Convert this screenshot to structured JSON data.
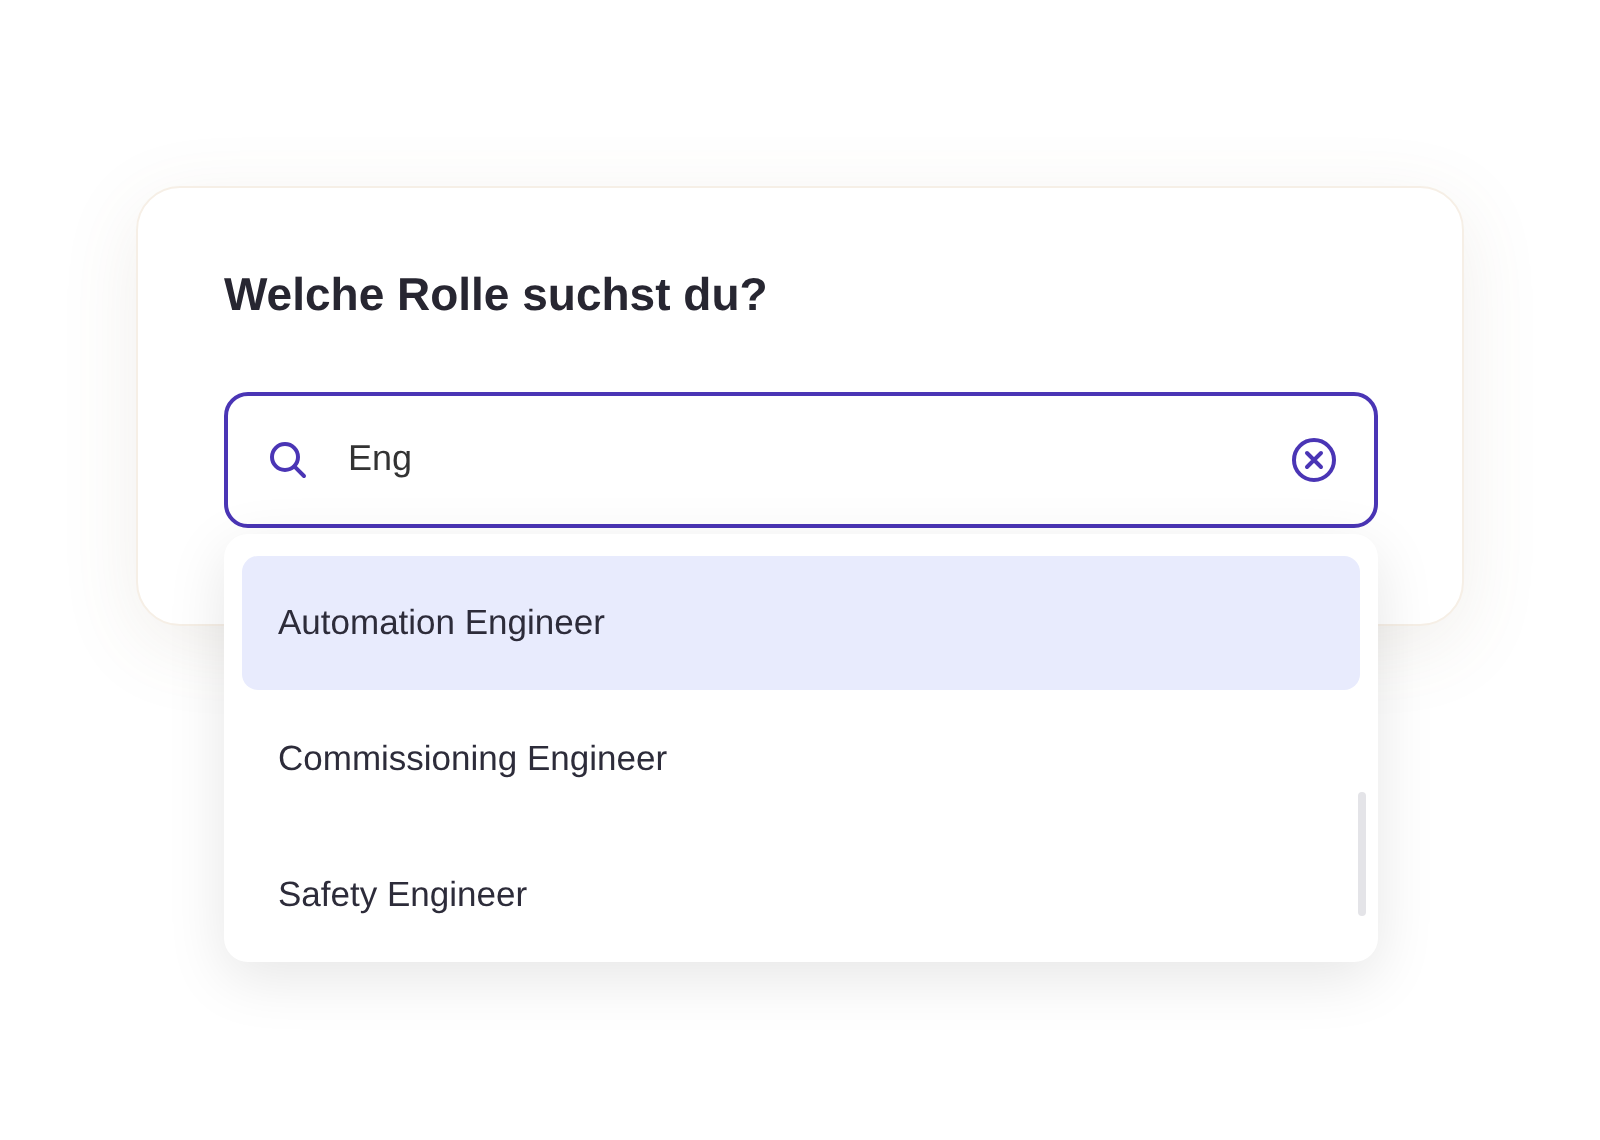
{
  "card": {
    "title": "Welche Rolle suchst du?"
  },
  "search": {
    "value": "Eng"
  },
  "options": [
    {
      "label": "Automation Engineer",
      "selected": true
    },
    {
      "label": "Commissioning Engineer",
      "selected": false
    },
    {
      "label": "Safety Engineer",
      "selected": false
    }
  ]
}
